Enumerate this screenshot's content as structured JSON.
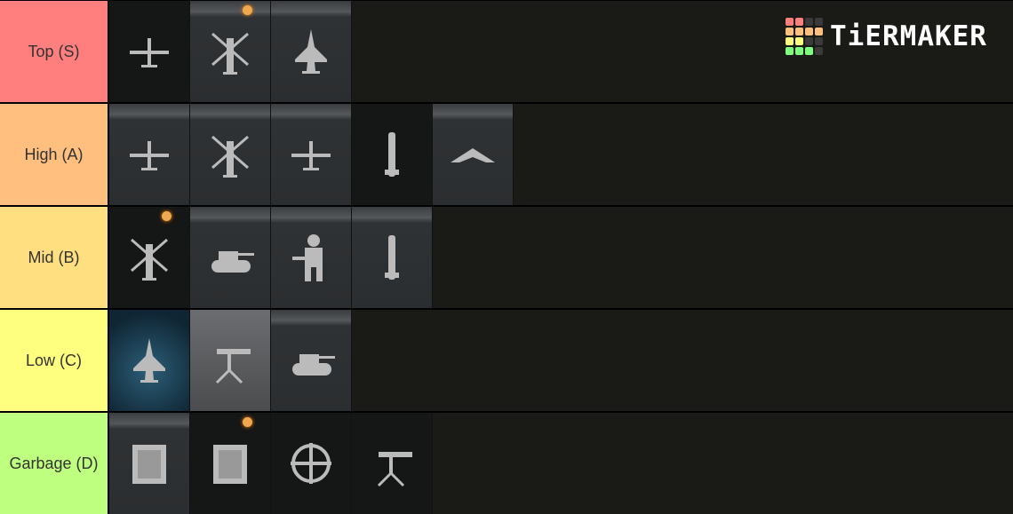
{
  "logo": {
    "text": "TiERMAKER",
    "grid": [
      [
        "#ff7f7f",
        "#ff7f7f",
        "#3a3a3a",
        "#3a3a3a"
      ],
      [
        "#ffbf7f",
        "#ffbf7f",
        "#ffbf7f",
        "#ffbf7f"
      ],
      [
        "#ffff7f",
        "#ffff7f",
        "#3a3a3a",
        "#3a3a3a"
      ],
      [
        "#7fff7f",
        "#7fff7f",
        "#7fff7f",
        "#3a3a3a"
      ]
    ]
  },
  "tiers": [
    {
      "label": "Top (S)",
      "color": "#ff7f7f",
      "items": [
        {
          "icon": "drone-plane-icon",
          "style": "dark"
        },
        {
          "icon": "attack-helicopter-icon",
          "dot": true
        },
        {
          "icon": "jet-fighter-icon"
        }
      ]
    },
    {
      "label": "High (A)",
      "color": "#ffbf7f",
      "items": [
        {
          "icon": "gunship-plane-icon"
        },
        {
          "icon": "chopper-gunner-icon"
        },
        {
          "icon": "airstrike-plane-icon"
        },
        {
          "icon": "cruise-missiles-icon",
          "style": "dark"
        },
        {
          "icon": "stealth-bomber-icon"
        }
      ]
    },
    {
      "label": "Mid (B)",
      "color": "#ffdf7f",
      "items": [
        {
          "icon": "helicopter-icon",
          "style": "dark",
          "dot": true
        },
        {
          "icon": "tank-icon"
        },
        {
          "icon": "juggernaut-soldier-icon"
        },
        {
          "icon": "missile-icon"
        }
      ]
    },
    {
      "label": "Low (C)",
      "color": "#ffff7f",
      "items": [
        {
          "icon": "jet-bombardment-icon",
          "style": "blue"
        },
        {
          "icon": "sentry-turret-icon",
          "style": "light"
        },
        {
          "icon": "armored-rover-icon"
        }
      ]
    },
    {
      "label": "Garbage (D)",
      "color": "#bfff7f",
      "items": [
        {
          "icon": "supply-crates-icon"
        },
        {
          "icon": "supply-drop-icon",
          "style": "dark",
          "dot": true
        },
        {
          "icon": "counter-uav-icon",
          "style": "dark"
        },
        {
          "icon": "machine-gun-turret-icon",
          "style": "dark"
        }
      ]
    }
  ]
}
